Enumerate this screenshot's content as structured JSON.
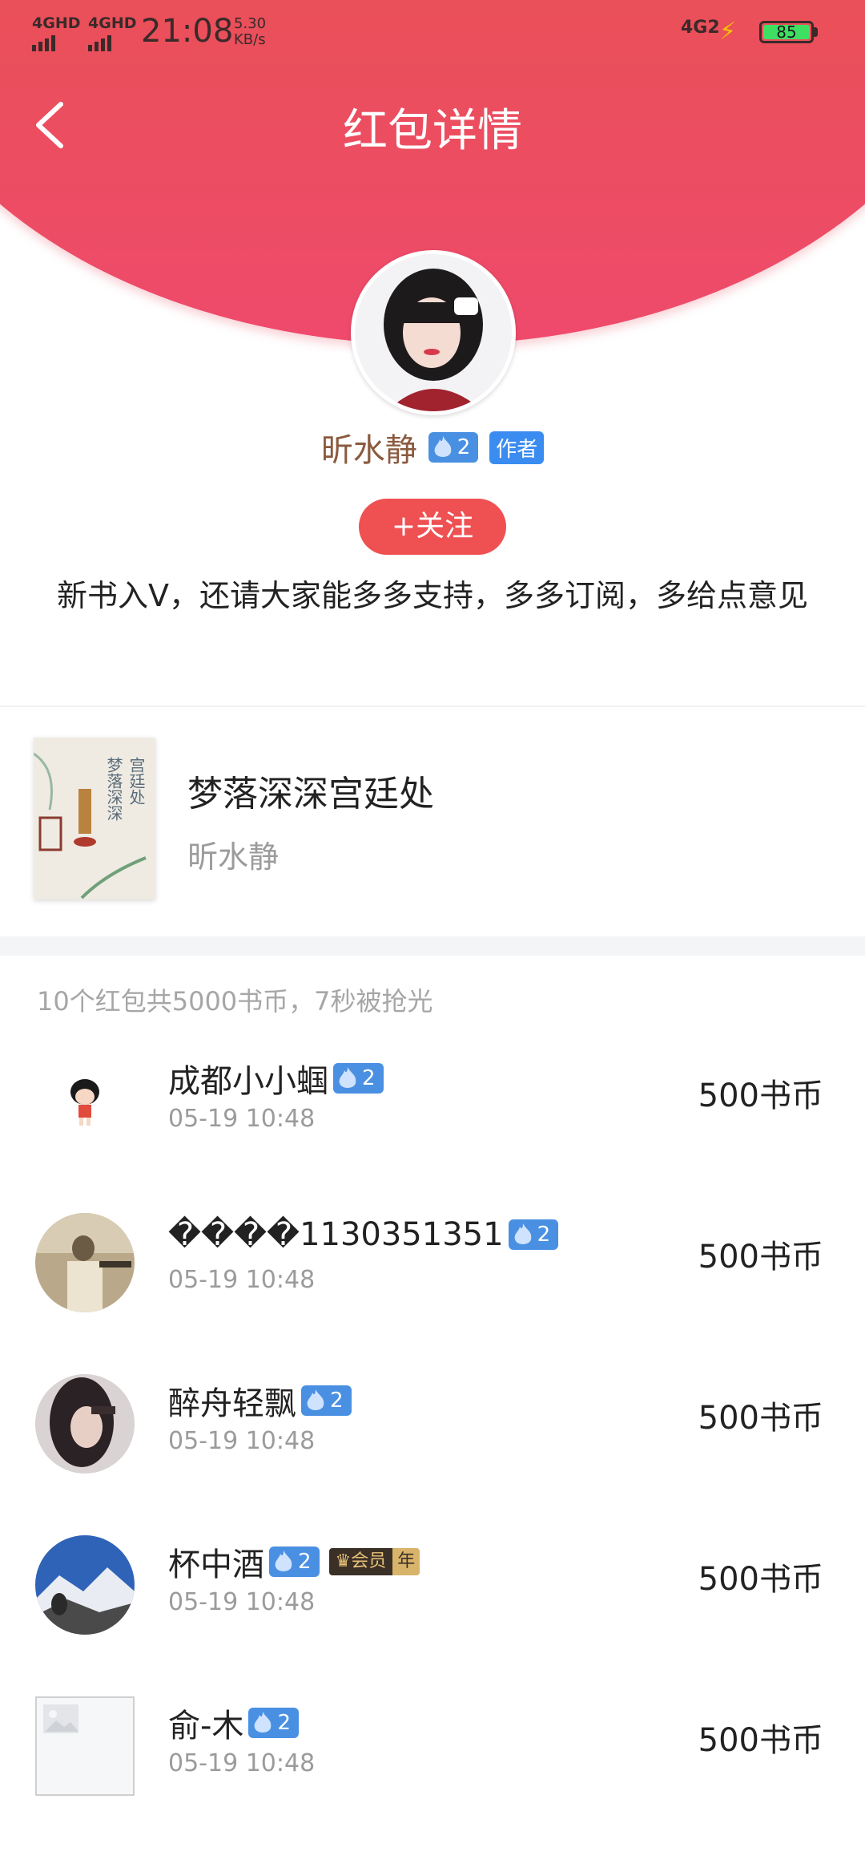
{
  "status_bar": {
    "sig1": "4GHD",
    "sig2": "4GHD",
    "time": "21:08",
    "speed_value": "5.30",
    "speed_unit": "KB/s",
    "network": "4G2",
    "battery": "85"
  },
  "header": {
    "title": "红包详情"
  },
  "author": {
    "name": "昕水静",
    "fan_level": "2",
    "tag": "作者",
    "follow_label": "+关注",
    "message": "新书入V，还请大家能多多支持，多多订阅，多给点意见"
  },
  "book": {
    "title": "梦落深深宫廷处",
    "author": "昕水静",
    "cover_title": "梦落深深宫廷处"
  },
  "summary": "10个红包共5000书币，7秒被抢光",
  "grabbers": [
    {
      "name": "成都小小蝈",
      "level": "2",
      "time": "05-19 10:48",
      "amount": "500书币",
      "avatar": "cartoon-girl"
    },
    {
      "name": "����1130351351",
      "level": "2",
      "time": "05-19 10:48",
      "amount": "500书币",
      "avatar": "old-photo"
    },
    {
      "name": "醉舟轻飘",
      "level": "2",
      "time": "05-19 10:48",
      "amount": "500书币",
      "avatar": "girl-dark"
    },
    {
      "name": "杯中酒",
      "level": "2",
      "time": "05-19 10:48",
      "amount": "500书币",
      "avatar": "mountain",
      "vip": "会员",
      "vip_year": "年"
    },
    {
      "name": "俞-木",
      "level": "2",
      "time": "05-19 10:48",
      "amount": "500书币",
      "avatar": "placeholder"
    }
  ],
  "colors": {
    "header_red": "#e8544f",
    "follow_button": "#ef5052",
    "fan_badge": "#4a90e2",
    "name_brown": "#8a5a3e"
  }
}
